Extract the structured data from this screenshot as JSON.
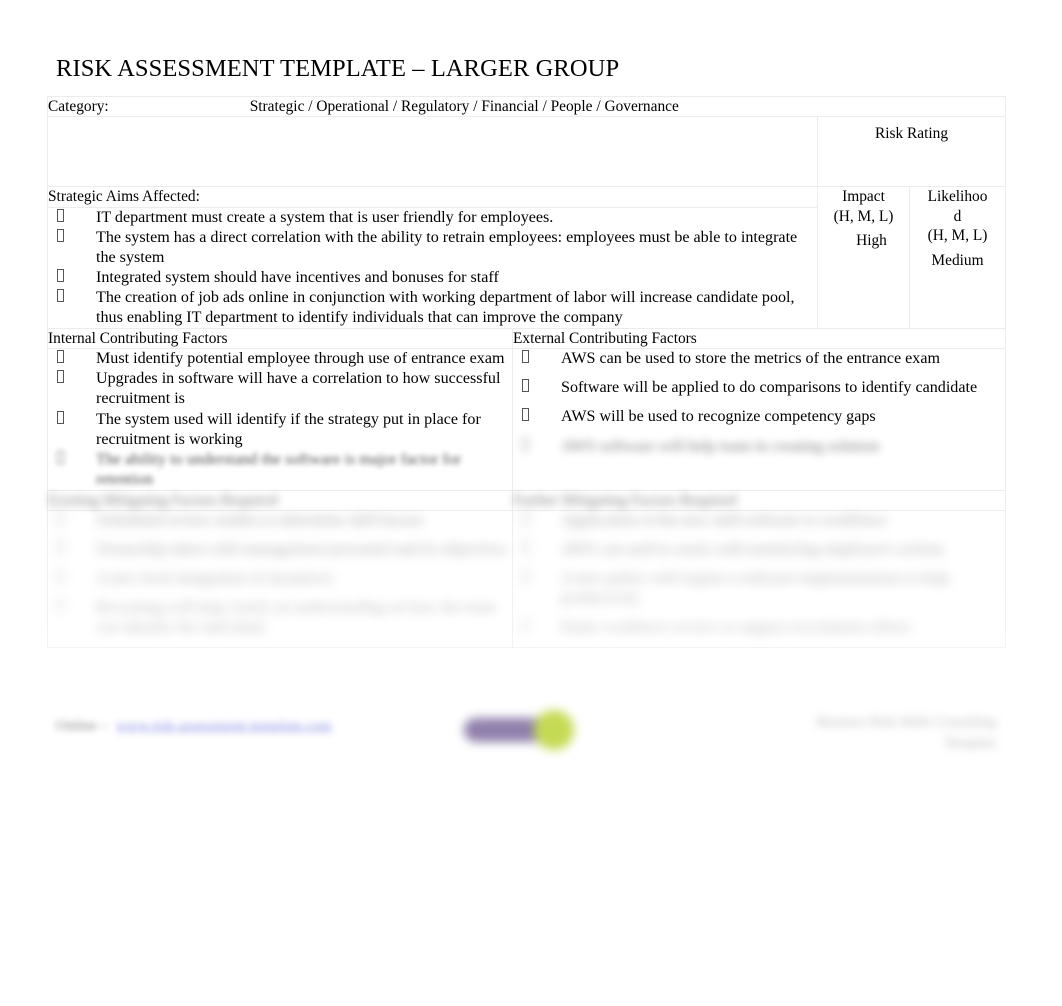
{
  "document": {
    "title": "RISK ASSESSMENT TEMPLATE – LARGER GROUP"
  },
  "category_row": {
    "label": "Category:",
    "options": "Strategic / Operational / Regulatory / Financial / People / Governance"
  },
  "description_cell": {
    "value": ""
  },
  "risk_rating": {
    "title": "Risk Rating",
    "impact_header_line1": "Impact",
    "impact_header_line2": "(H, M, L)",
    "likelihood_header_line1": "Likelihoo",
    "likelihood_header_line2": "d",
    "likelihood_header_line3": "(H, M, L)",
    "impact_value": "High",
    "likelihood_value": "Medium"
  },
  "strategic_aims": {
    "heading": "Strategic Aims Affected:",
    "items": [
      "IT department must create a system that is user friendly for employees.",
      "The system has a direct correlation with the ability to retrain employees: employees must be able to integrate the system",
      " Integrated system should have incentives and bonuses for staff",
      "The creation of job ads online in conjunction with working department of labor will increase candidate pool, thus enabling IT department to identify individuals that can improve the company"
    ]
  },
  "internal_factors": {
    "heading": "Internal Contributing Factors",
    "items": [
      "Must identify potential employee through use of entrance exam",
      "Upgrades in software will have a correlation to how successful recruitment is",
      "The system used will identify if the strategy put in place for recruitment is working",
      "The ability to understand the software is major factor for retention"
    ]
  },
  "external_factors": {
    "heading": "External Contributing Factors",
    "items": [
      "AWS can be used to store the metrics of the entrance exam",
      "Software will be applied to do comparisons to identify candidate",
      "AWS will be used to recognize competency gaps",
      "AWS software will help team in creating solution"
    ]
  },
  "internal_mitigating": {
    "heading": "Existing Mitigating Factors Required",
    "items": [
      "Scheduled review studies to determine skill factors",
      "Ownership taken with management personnel and its objectives",
      "A new level integration of incentives",
      "Recruiting will help clarify an understanding on how the team can identify the individual"
    ]
  },
  "external_mitigating": {
    "heading": "Further Mitigating Factors Required",
    "items": [
      "Application of the new skill software to workforce",
      "AWS can used to assist with monitoring employee's actions",
      "A new policy will require a software implementation to help productivity",
      "Entire workforce review to support recruitment efforts"
    ]
  },
  "footer": {
    "link_label": "Online  –",
    "link_url": "www.risk-assessment-template.com",
    "right_line1": "Business Risk Skills Consulting",
    "right_line2": "Template"
  }
}
